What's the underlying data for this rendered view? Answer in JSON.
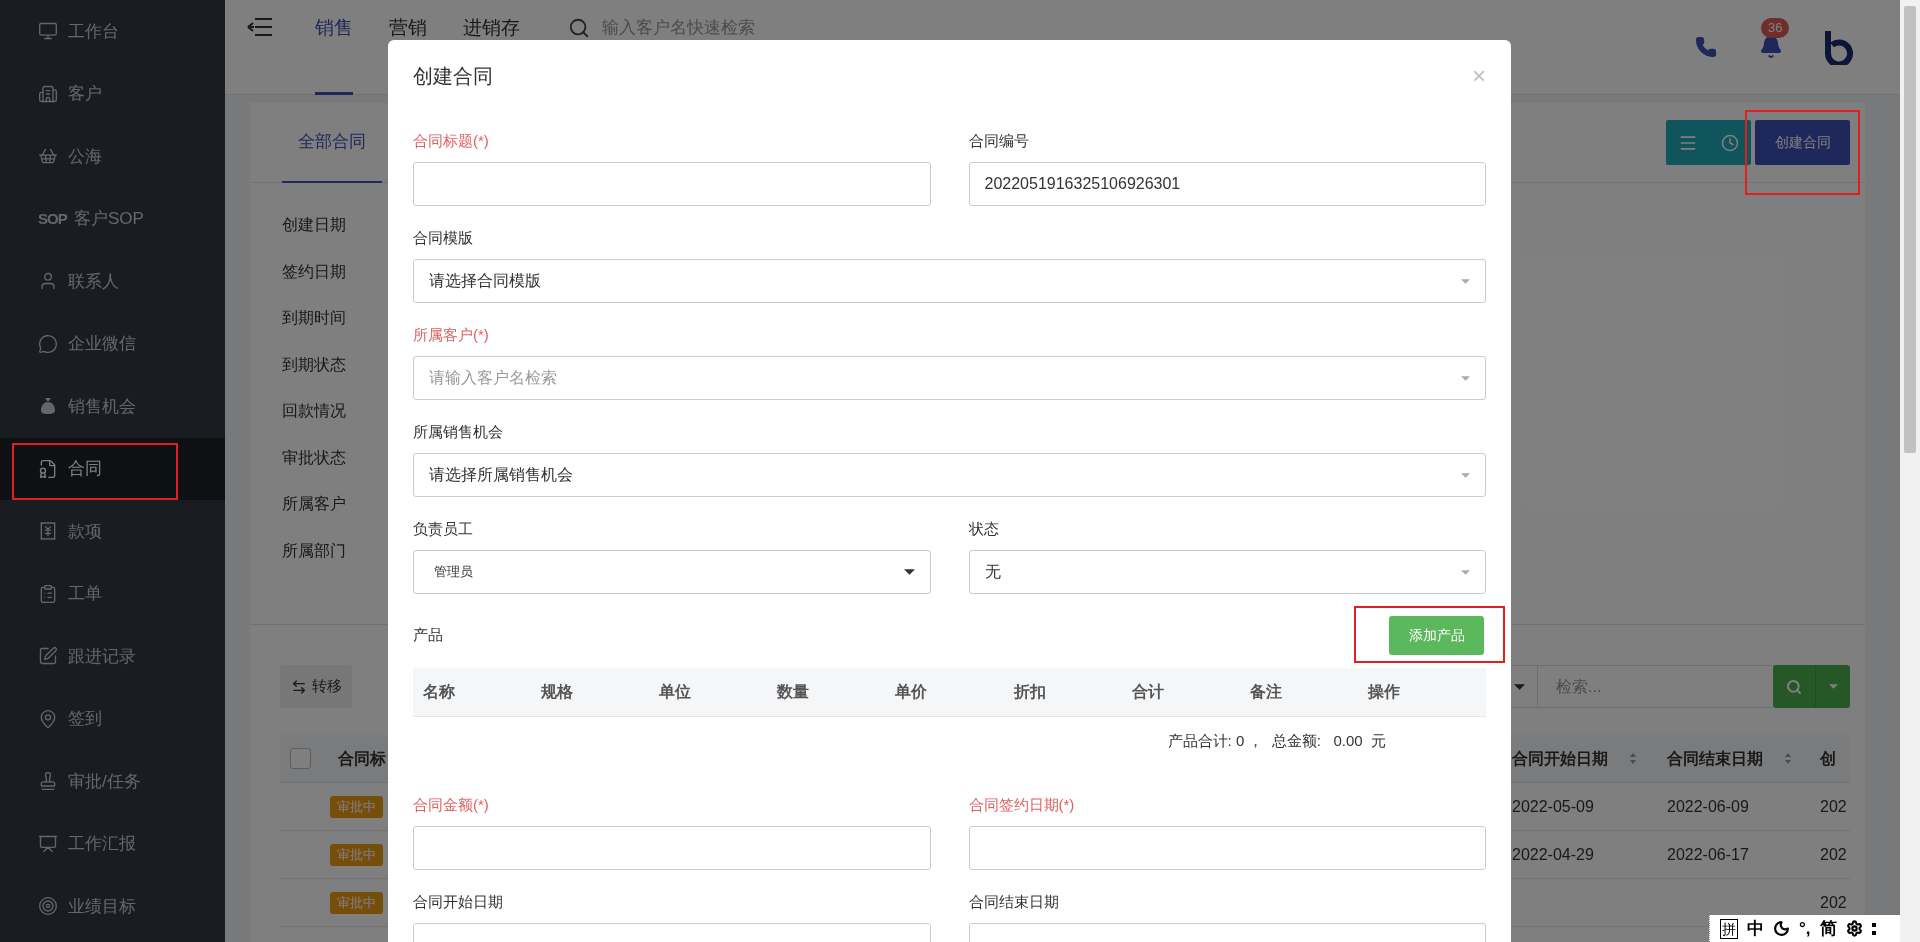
{
  "sidebar": {
    "items": [
      {
        "label": "工作台",
        "selected": false
      },
      {
        "label": "客户",
        "selected": false
      },
      {
        "label": "公海",
        "selected": false
      },
      {
        "label": "客户SOP",
        "selected": false,
        "icon_text": "SOP"
      },
      {
        "label": "联系人",
        "selected": false
      },
      {
        "label": "企业微信",
        "selected": false
      },
      {
        "label": "销售机会",
        "selected": false
      },
      {
        "label": "合同",
        "selected": true
      },
      {
        "label": "款项",
        "selected": false
      },
      {
        "label": "工单",
        "selected": false
      },
      {
        "label": "跟进记录",
        "selected": false
      },
      {
        "label": "签到",
        "selected": false
      },
      {
        "label": "审批/任务",
        "selected": false
      },
      {
        "label": "工作汇报",
        "selected": false
      },
      {
        "label": "业绩目标",
        "selected": false
      }
    ]
  },
  "top_nav": {
    "tabs": [
      {
        "label": "销售",
        "selected": true
      },
      {
        "label": "营销",
        "selected": false
      },
      {
        "label": "进销存",
        "selected": false
      }
    ],
    "search": {
      "placeholder": "输入客户名快速检索"
    },
    "notification_count": "36"
  },
  "page": {
    "tabs": [
      {
        "label": "全部合同",
        "selected": true
      }
    ],
    "create_button": "创建合同",
    "filters": [
      "创建日期",
      "签约日期",
      "到期时间",
      "到期状态",
      "回款情况",
      "审批状态",
      "所属客户",
      "所属部门"
    ],
    "transfer_button": "转移",
    "search": {
      "placeholder": "检索..."
    },
    "table": {
      "select_all": {
        "checked": false
      },
      "columns": [
        {
          "label": "合同标",
          "sortable": false
        },
        {
          "label": "合同开始日期",
          "sortable": true
        },
        {
          "label": "合同结束日期",
          "sortable": true
        },
        {
          "label": "创",
          "sortable": false
        }
      ],
      "rows": [
        {
          "status": "审批中",
          "start": "2022-05-09",
          "end": "2022-06-09",
          "created": "202"
        },
        {
          "status": "审批中",
          "start": "2022-04-29",
          "end": "2022-06-17",
          "created": "202"
        },
        {
          "status": "审批中",
          "created": "202"
        }
      ]
    }
  },
  "modal": {
    "title": "创建合同",
    "close": "×",
    "rows": [
      [
        {
          "kind": "text",
          "label": "合同标题(*)",
          "required": true
        },
        {
          "kind": "text",
          "label": "合同编号",
          "required": false,
          "value": "2022051916325106926301"
        }
      ],
      [
        {
          "kind": "select",
          "label": "合同模版",
          "required": false,
          "value": "请选择合同模版"
        }
      ],
      [
        {
          "kind": "select",
          "label": "所属客户(*)",
          "required": true,
          "placeholder": "请输入客户名检索"
        }
      ],
      [
        {
          "kind": "select",
          "label": "所属销售机会",
          "required": false,
          "value": "请选择所属销售机会"
        }
      ],
      [
        {
          "kind": "native_select",
          "label": "负责员工",
          "required": false,
          "value": "管理员"
        },
        {
          "kind": "select",
          "label": "状态",
          "required": false,
          "value": "无"
        }
      ]
    ],
    "products": {
      "label": "产品",
      "add_button": "添加产品",
      "columns": [
        "名称",
        "规格",
        "单位",
        "数量",
        "单价",
        "折扣",
        "合计",
        "备注",
        "操作"
      ],
      "summary": "产品合计: 0 ，  总金额:   0.00  元"
    },
    "rows_after": [
      [
        {
          "kind": "text",
          "label": "合同金额(*)",
          "required": true
        },
        {
          "kind": "text",
          "label": "合同签约日期(*)",
          "required": true
        }
      ],
      [
        {
          "kind": "text",
          "label": "合同开始日期",
          "required": false
        },
        {
          "kind": "text",
          "label": "合同结束日期",
          "required": false
        }
      ]
    ]
  },
  "ime_bar": {
    "items": [
      {
        "kind": "boxed",
        "text": "拼"
      },
      {
        "kind": "text",
        "text": "中"
      },
      {
        "kind": "moon"
      },
      {
        "kind": "text",
        "text": "°,"
      },
      {
        "kind": "text",
        "text": "简"
      },
      {
        "kind": "gear"
      },
      {
        "kind": "dots"
      }
    ]
  }
}
